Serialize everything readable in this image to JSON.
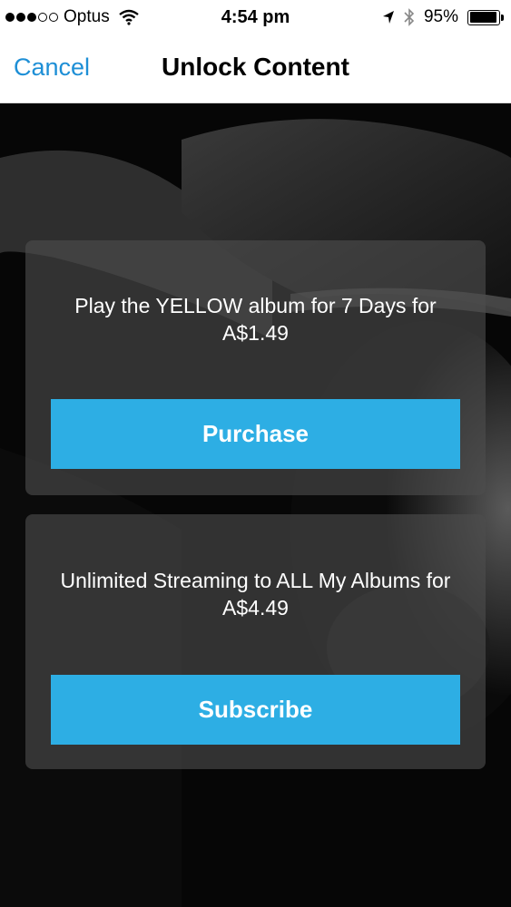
{
  "status_bar": {
    "carrier": "Optus",
    "time": "4:54 pm",
    "battery": "95%",
    "battery_level": 0.95,
    "signal_bars_filled": 3,
    "signal_bars_total": 5
  },
  "nav": {
    "cancel_label": "Cancel",
    "title": "Unlock Content"
  },
  "offers": [
    {
      "description": "Play the YELLOW album for 7 Days for A$1.49",
      "button_label": "Purchase"
    },
    {
      "description": "Unlimited Streaming to ALL My Albums for A$4.49",
      "button_label": "Subscribe"
    }
  ],
  "colors": {
    "accent": "#1e8fd6",
    "button": "#2daee4"
  },
  "icons": {
    "wifi": "wifi-icon",
    "location": "location-arrow-icon",
    "bluetooth": "bluetooth-icon",
    "battery": "battery-icon"
  }
}
